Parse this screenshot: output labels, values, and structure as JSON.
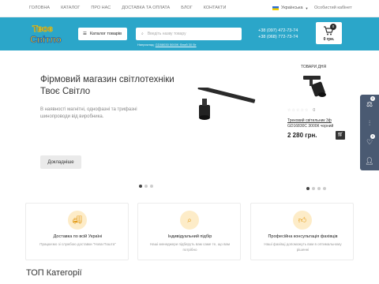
{
  "topnav": [
    "ГОЛОВНА",
    "КАТАЛОГ",
    "ПРО НАС",
    "ДОСТАВКА ТА ОПЛАТА",
    "БЛОГ",
    "КОНТАКТИ"
  ],
  "language": "Українська",
  "cabinet": "Особистий кабінет",
  "catalog_button": "Каталог товарів",
  "search": {
    "placeholder": "Введіть назву товару"
  },
  "search_hint": {
    "prefix": "Наприклад:",
    "link": "GD58030 5000K білий 30 Вт"
  },
  "phones": [
    "+38 (097) 472-73-74",
    "+38 (068) 772-73-74"
  ],
  "cart": {
    "count": "0",
    "total": "0 грн."
  },
  "hero": {
    "title": "Фірмовий магазин світлотехніки Твоє Світло",
    "text": "В наявності магнітні, однофазні та трифазні шинопроводи від виробника.",
    "button": "Докладніше"
  },
  "product_of_day": {
    "heading": "ТОВАРИ ДНЯ",
    "reviews": "0",
    "name_line1": "Трековий світильник 3ф",
    "name_line2": "GD16830C 3000К чорний",
    "price": "2 280 грн."
  },
  "side_panel": {
    "compare_count": "0",
    "wishlist_count": "0"
  },
  "features": [
    {
      "title": "Доставка по всій Україні",
      "text": "Працюємо зі службою доставки \"Нова Пошта\""
    },
    {
      "title": "Індивідуальний підбір",
      "text": "Наші менеджери підберуть вам саме те, що вам потрібно"
    },
    {
      "title": "Професійна консультація фахівців",
      "text": "Наші фахівці допоможуть вам в оптимальному рішенні"
    }
  ],
  "section_title": "ТОП Категорії",
  "colors": {
    "header": "#2ba6c9",
    "logo_blue": "#1e63b5",
    "logo_yellow": "#f5c400",
    "side_panel": "#4a5a72"
  },
  "icons": [
    "catalog-menu-icon",
    "search-icon",
    "cart-icon",
    "user-icon",
    "compare-icon",
    "filter-icon",
    "heart-icon",
    "truck-icon",
    "magnifier-icon",
    "consultant-icon"
  ]
}
